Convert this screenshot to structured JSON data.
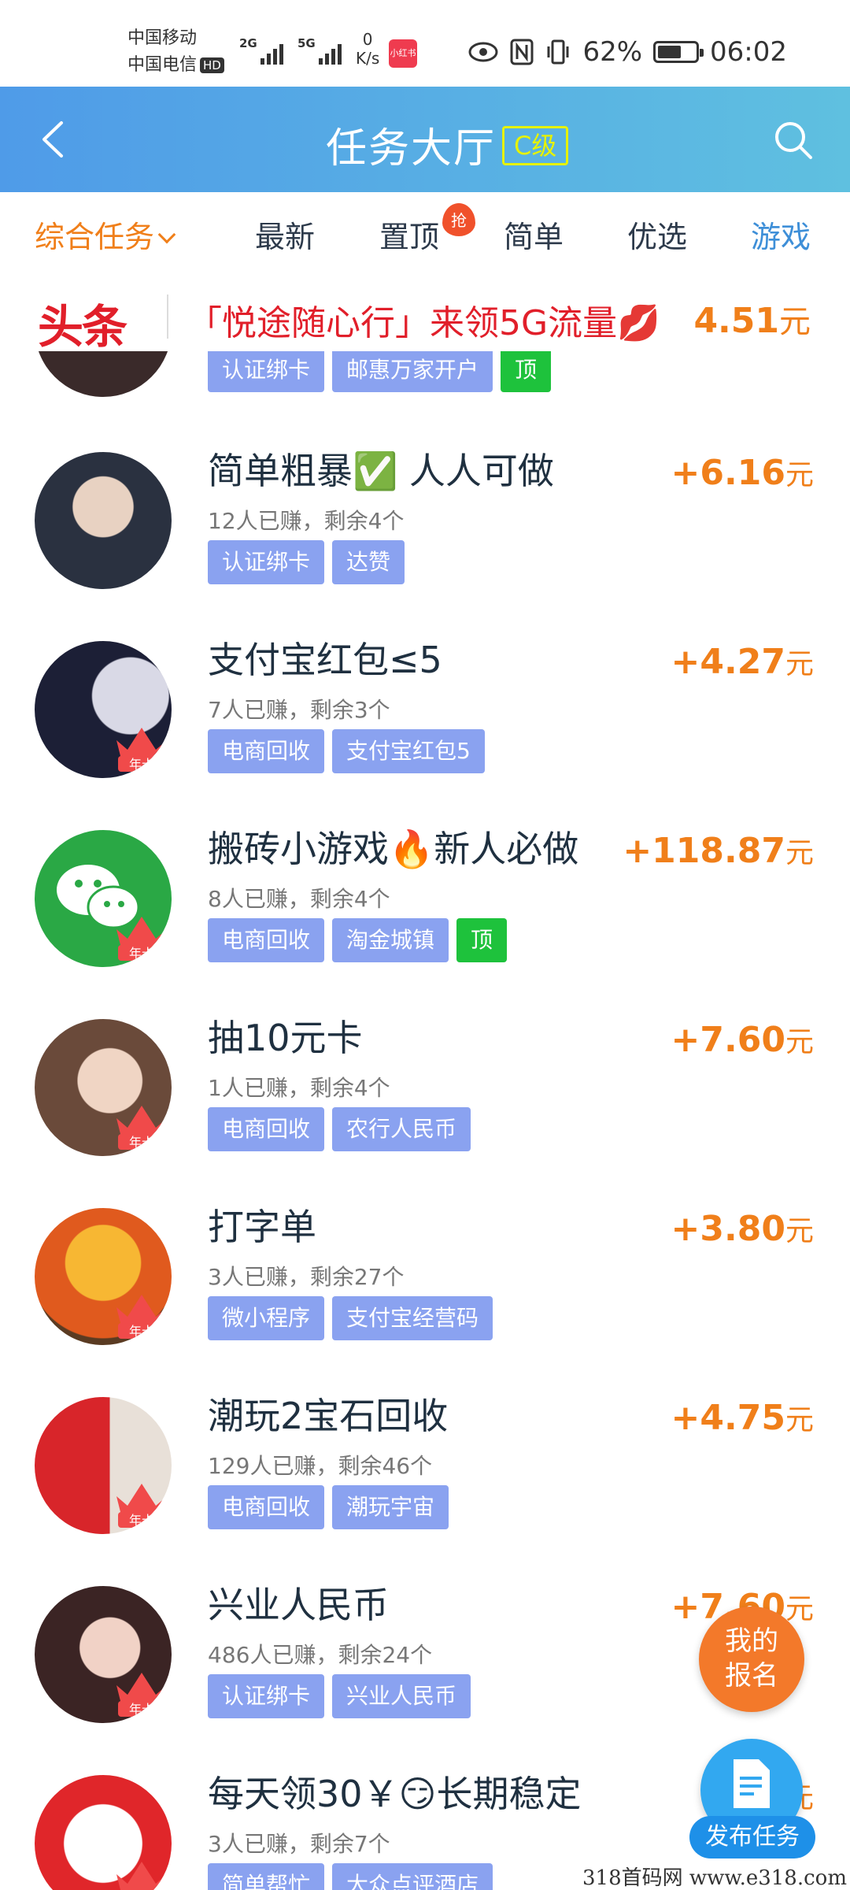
{
  "status_bar": {
    "carrier1": "中国移动",
    "carrier2": "中国电信",
    "hd": "HD",
    "sig1_gen": "2G",
    "sig2_gen": "5G",
    "speed_value": "0",
    "speed_unit": "K/s",
    "app_notification": "小红书",
    "battery_percent": "62%",
    "battery_level": 0.62,
    "time": "06:02"
  },
  "header": {
    "title": "任务大厅",
    "level_badge": "C级"
  },
  "tabs": [
    {
      "label": "综合任务"
    },
    {
      "label": "最新"
    },
    {
      "label": "置顶"
    },
    {
      "label": "简单"
    },
    {
      "label": "优选"
    },
    {
      "label": "游戏"
    }
  ],
  "tab_hot_badge": "抢",
  "headline": {
    "logo": "头条",
    "text": "「悦途随心行」来领5G流量💋",
    "price": "4.51",
    "unit": "元"
  },
  "partial_item": {
    "tags": [
      "认证绑卡",
      "邮惠万家开户",
      "顶"
    ]
  },
  "items": [
    {
      "title": "简单粗暴✅ 人人可做",
      "sub": "12人已赚，剩余4个",
      "price": "+6.16",
      "unit": "元",
      "tags": [
        "认证绑卡",
        "达赞"
      ],
      "badge": ""
    },
    {
      "title": "支付宝红包≤5",
      "sub": "7人已赚，剩余3个",
      "price": "+4.27",
      "unit": "元",
      "tags": [
        "电商回收",
        "支付宝红包5"
      ],
      "badge": "年卡"
    },
    {
      "title": "搬砖小游戏🔥新人必做",
      "sub": "8人已赚，剩余4个",
      "price": "+118.87",
      "unit": "元",
      "tags": [
        "电商回收",
        "淘金城镇",
        "顶"
      ],
      "badge": "年卡"
    },
    {
      "title": "抽10元卡",
      "sub": "1人已赚，剩余4个",
      "price": "+7.60",
      "unit": "元",
      "tags": [
        "电商回收",
        "农行人民币"
      ],
      "badge": "年卡"
    },
    {
      "title": "打字单",
      "sub": "3人已赚，剩余27个",
      "price": "+3.80",
      "unit": "元",
      "tags": [
        "微小程序",
        "支付宝经营码"
      ],
      "badge": "年卡"
    },
    {
      "title": "潮玩2宝石回收",
      "sub": "129人已赚，剩余46个",
      "price": "+4.75",
      "unit": "元",
      "tags": [
        "电商回收",
        "潮玩宇宙"
      ],
      "badge": "年卡"
    },
    {
      "title": "兴业人民币",
      "sub": "486人已赚，剩余24个",
      "price": "+7.60",
      "unit": "元",
      "tags": [
        "认证绑卡",
        "兴业人民币"
      ],
      "badge": "年卡"
    },
    {
      "title": "每天领30￥😏长期稳定",
      "sub": "3人已赚，剩余7个",
      "price": "+",
      "unit": "元",
      "tags": [
        "简单帮忙",
        "大众点评酒店"
      ],
      "badge": "年卡"
    }
  ],
  "fab": {
    "signup_line1": "我的",
    "signup_line2": "报名",
    "publish": "发布任务"
  },
  "watermark": "318首码网  www.e318.com",
  "colors": {
    "accent_orange": "#f07f1a",
    "header_start": "#4f9be8",
    "header_end": "#5fc0e0",
    "tag_blue": "#8aa2f0",
    "tag_green": "#1ec23c",
    "headline_red": "#e11f2a"
  }
}
